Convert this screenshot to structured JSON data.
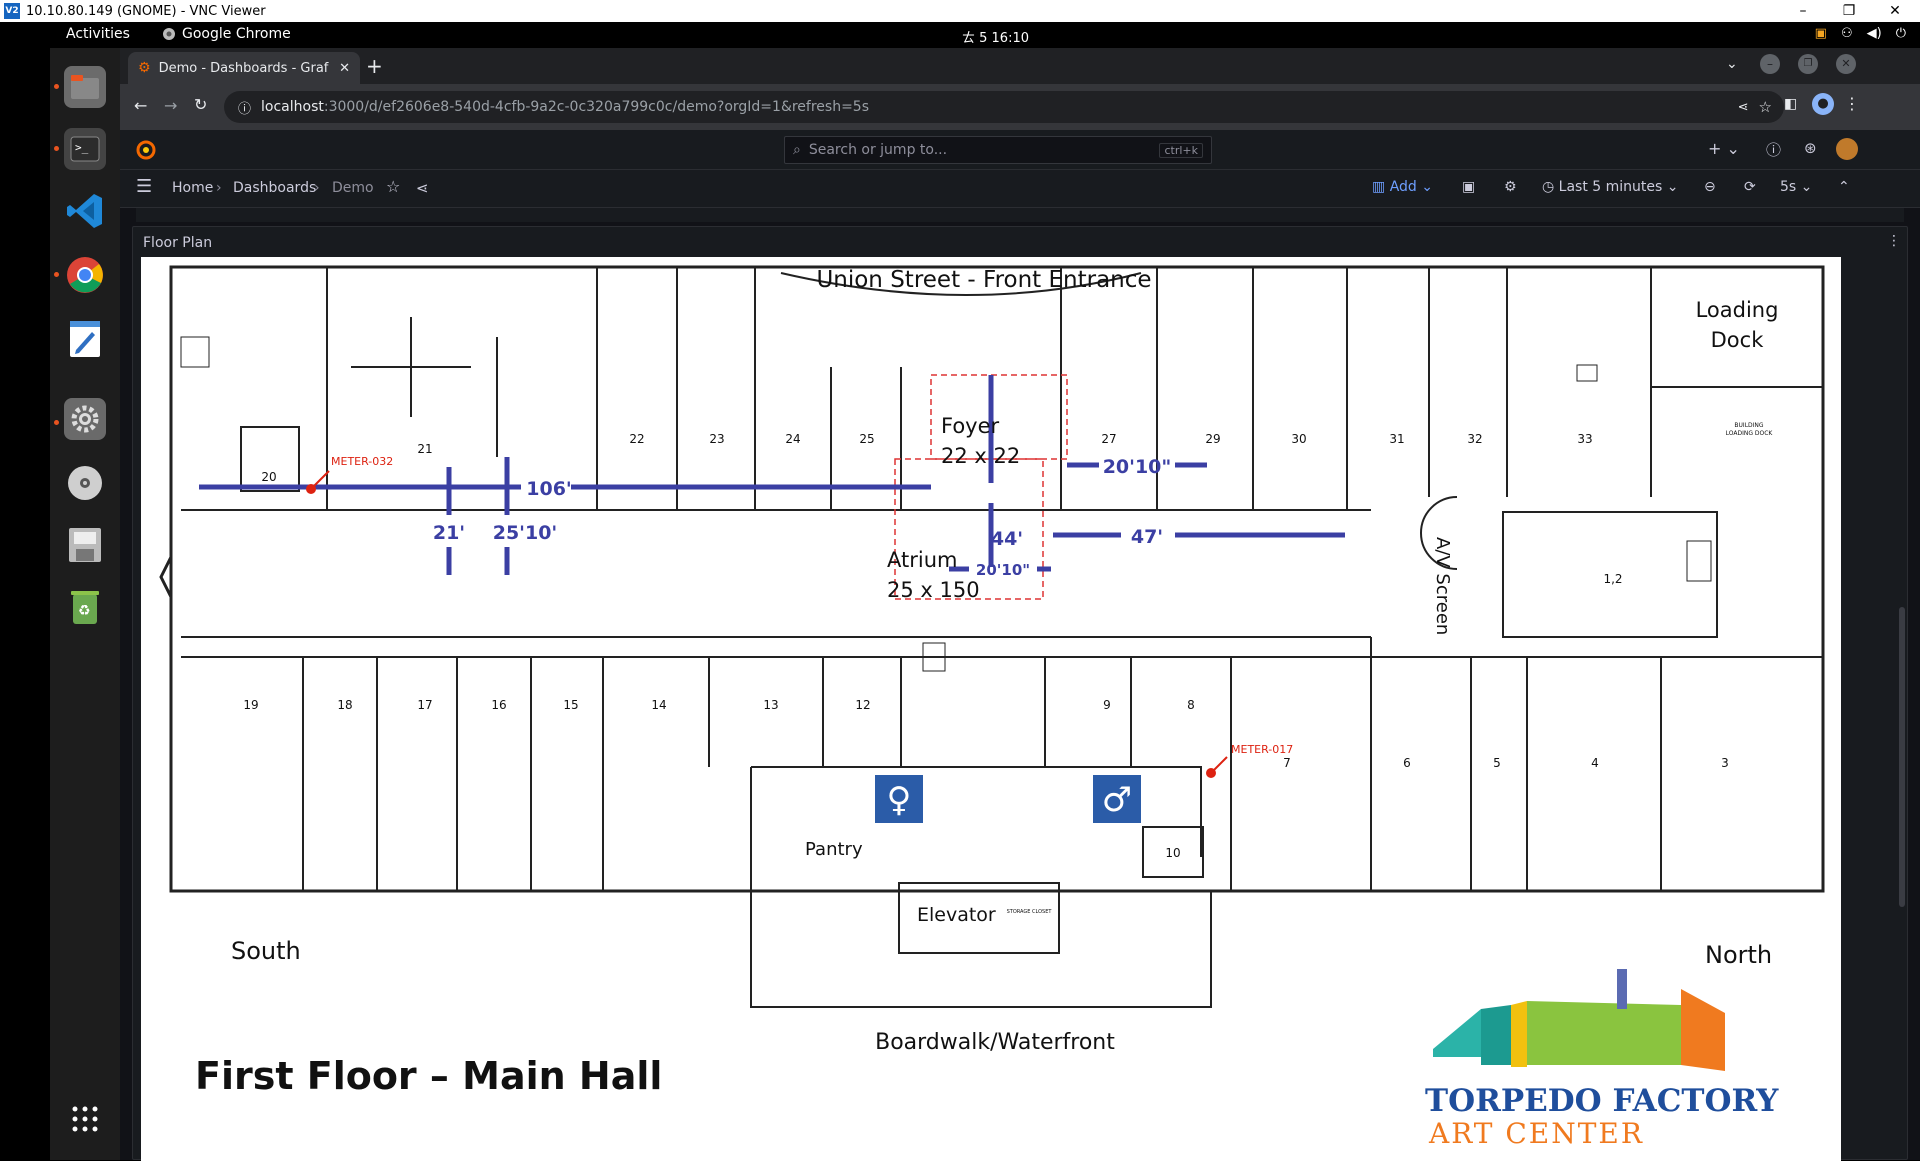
{
  "vnc": {
    "title": "10.10.80.149 (GNOME) - VNC Viewer",
    "logo": "V2"
  },
  "gnome": {
    "activities": "Activities",
    "app_name": "Google Chrome",
    "clock": "ㄊ 5  16:10"
  },
  "browser": {
    "tab_title": "Demo - Dashboards - Graf",
    "url_host": "localhost",
    "url_path": ":3000/d/ef2606e8-540d-4cfb-9a2c-0c320a799c0c/demo?orgId=1&refresh=5s"
  },
  "grafana": {
    "search_placeholder": "Search or jump to...",
    "search_shortcut": "ctrl+k",
    "breadcrumbs": [
      "Home",
      "Dashboards",
      "Demo"
    ],
    "add_label": "Add",
    "time_range": "Last 5 minutes",
    "refresh_interval": "5s",
    "panel_title": "Floor Plan"
  },
  "floorplan": {
    "front": "Union Street - Front Entrance",
    "loading_dock_1": "Loading",
    "loading_dock_2": "Dock",
    "building_loading_dock_1": "BUILDING",
    "building_loading_dock_2": "LOADING DOCK",
    "foyer": "Foyer",
    "foyer_size": "22  x   22",
    "atrium": "Atrium",
    "atrium_size": "25 x 150",
    "av_screen": "A/V Screen",
    "dim_106": "106'",
    "dim_44": "44'",
    "dim_2010_top": "20'10\"",
    "dim_2010_bottom": "20'10\"",
    "dim_47": "47'",
    "dim_21": "21'",
    "dim_2510": "25'10'",
    "meter_032": "METER-032",
    "meter_017": "METER-017",
    "pantry": "Pantry",
    "elevator": "Elevator",
    "storage_closet": "STORAGE CLOSET",
    "south": "South",
    "north": "North",
    "boardwalk": "Boardwalk/Waterfront",
    "floor_title": "First Floor – Main Hall",
    "logo_line1": "TORPEDO FACTORY",
    "logo_line2": "ART CENTER",
    "rooms_top": [
      "21",
      "22",
      "23",
      "24",
      "25",
      "27",
      "29",
      "30",
      "31",
      "32",
      "33"
    ],
    "room_20": "20",
    "room_12b": "1,2",
    "rooms_bottom": [
      "19",
      "18",
      "17",
      "16",
      "15",
      "14",
      "13",
      "12",
      "9",
      "8",
      "7",
      "6",
      "5",
      "4",
      "3"
    ],
    "room_10": "10"
  }
}
